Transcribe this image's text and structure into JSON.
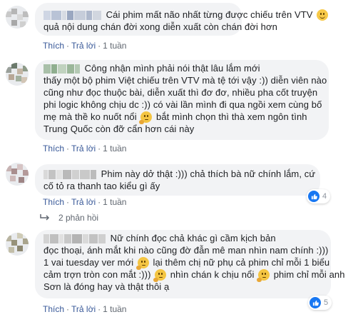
{
  "comments": [
    {
      "lines": [
        "Cái phim mất não nhất từng được chiếu trên VTV",
        "quả nội dung chán đời xong diễn xuất còn chán đời hơn"
      ],
      "actions": {
        "like": "Thích",
        "reply": "Trả lời",
        "time": "1 tuần"
      }
    },
    {
      "lines": [
        "Công nhận mình phải nói thật lâu lắm mới",
        "thấy một bộ phim Việt chiếu trên VTV mà tệ tới vậy :)) diễn viên nào",
        "cũng như đọc thuộc bài, diễn xuất thì đơ đơ, nhiều pha cốt truyện",
        "phi logic không chịu dc :)) có vài lần mình đi qua ngồi xem cùng bố",
        "mẹ mà thề ko nuốt nổi",
        "bắt mình chọn thì thà xem ngôn tình",
        "Trung Quốc còn đỡ cẩn hơn cái này"
      ],
      "actions": {
        "like": "Thích",
        "reply": "Trả lời",
        "time": "1 tuần"
      }
    },
    {
      "lines": [
        "Phim này dở thật :))) chả thích bà nữ chính lắm, cứ",
        "cố tỏ ra thanh tao kiểu gì ấy"
      ],
      "actions": {
        "like": "Thích",
        "reply": "Trả lời",
        "time": "1 tuần"
      },
      "reaction_count": "4"
    },
    {
      "lines": [
        "Nữ chính đọc chả khác gì cầm kịch bản",
        "đọc thoại, ánh mắt khi nào cũng đờ đẫn mê man nhìn nam chính :)))",
        "1 vai tuesday ver mới",
        "lại thêm chị nữ phụ cả phim chỉ mỗi 1 biểu",
        "cảm trợn tròn con mắt :)))",
        "nhìn chán k chịu nổi",
        "phim chỉ mỗi anh",
        "Sơn là đóng hay và thật thôi ạ"
      ],
      "actions": {
        "like": "Thích",
        "reply": "Trả lời",
        "time": "1 tuần"
      },
      "reaction_count": "5"
    }
  ],
  "replies_link": "2 phản hồi",
  "icons": {
    "like": "thumbs-up-icon",
    "emoji_smile": "smile-emoji-icon",
    "emoji_think": "thinking-emoji-icon",
    "reply_arrow": "reply-arrow-icon"
  },
  "colors": {
    "link": "#385898",
    "bubble": "#f2f3f5",
    "like_blue": "#1877f2",
    "meta": "#606770"
  }
}
